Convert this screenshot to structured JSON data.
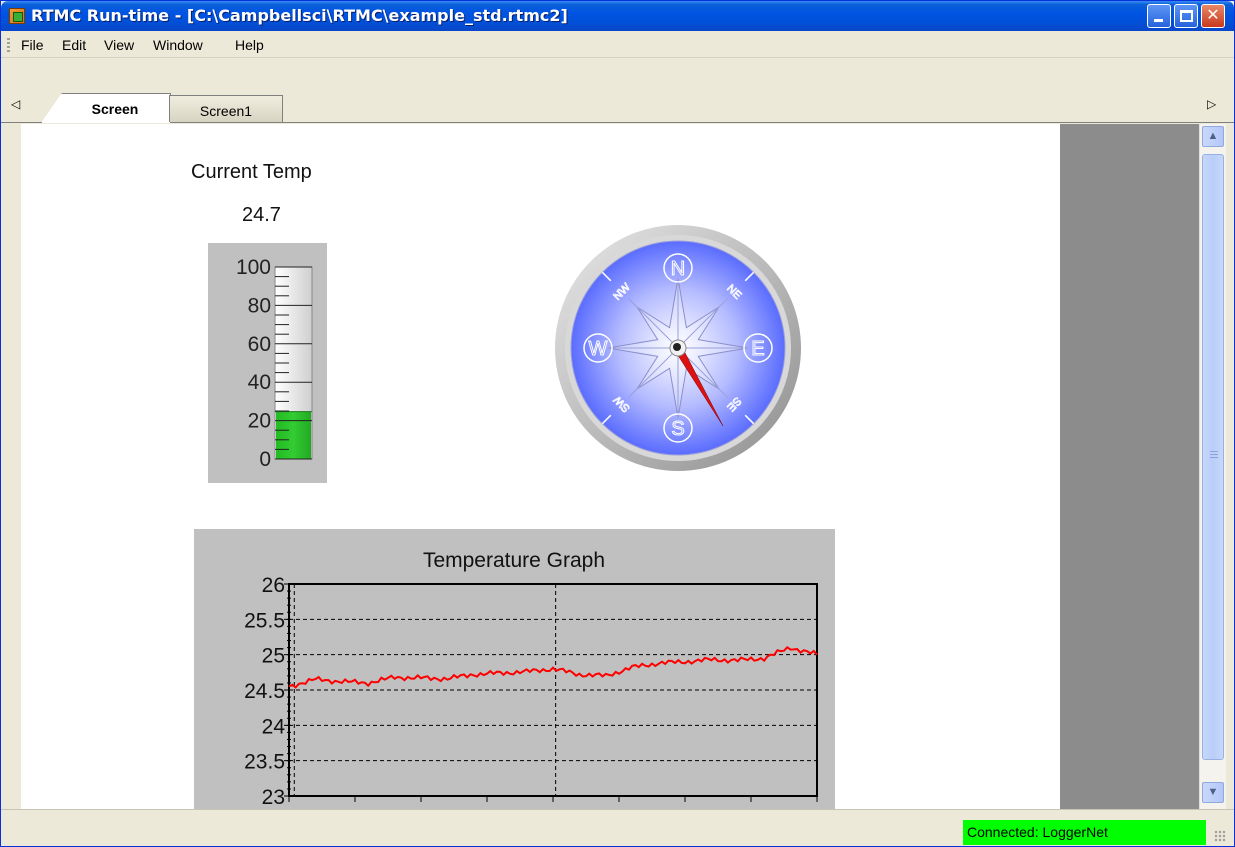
{
  "window": {
    "title": "RTMC Run-time - [C:\\Campbellsci\\RTMC\\example_std.rtmc2]"
  },
  "menu": {
    "items": [
      "File",
      "Edit",
      "View",
      "Window",
      "Help"
    ]
  },
  "tabs": {
    "active": "Screen",
    "inactive": "Screen1"
  },
  "thermometer": {
    "title": "Current Temp",
    "value_text": "24.7",
    "value": 24.7,
    "min": 0,
    "max": 100,
    "tick_labels": [
      "100",
      "80",
      "60",
      "40",
      "20",
      "0"
    ],
    "fill_color": "#33cc33"
  },
  "compass": {
    "cardinals": [
      "N",
      "E",
      "S",
      "W"
    ],
    "intercardinals": [
      "NE",
      "SE",
      "SW",
      "NW"
    ],
    "heading_deg": 150,
    "needle_color": "#dd1111",
    "face_color": "#5a6cff"
  },
  "chart_data": {
    "type": "line",
    "title": "Temperature Graph",
    "ylim": [
      23,
      26
    ],
    "y_ticks": [
      "26",
      "25.5",
      "25",
      "24.5",
      "24",
      "23.5",
      "23"
    ],
    "grid": true,
    "series": [
      {
        "color": "#ff0000",
        "x": [
          0,
          0.05,
          0.1,
          0.15,
          0.2,
          0.25,
          0.3,
          0.35,
          0.4,
          0.45,
          0.5,
          0.55,
          0.6,
          0.65,
          0.7,
          0.75,
          0.8,
          0.85,
          0.9,
          0.95,
          1.0
        ],
        "values": [
          24.55,
          24.65,
          24.62,
          24.6,
          24.68,
          24.67,
          24.66,
          24.72,
          24.74,
          24.76,
          24.8,
          24.72,
          24.7,
          24.82,
          24.88,
          24.9,
          24.93,
          24.92,
          24.95,
          25.1,
          25.0
        ]
      }
    ]
  },
  "status": {
    "connection": "Connected: LoggerNet",
    "connection_color": "#00ff00"
  }
}
